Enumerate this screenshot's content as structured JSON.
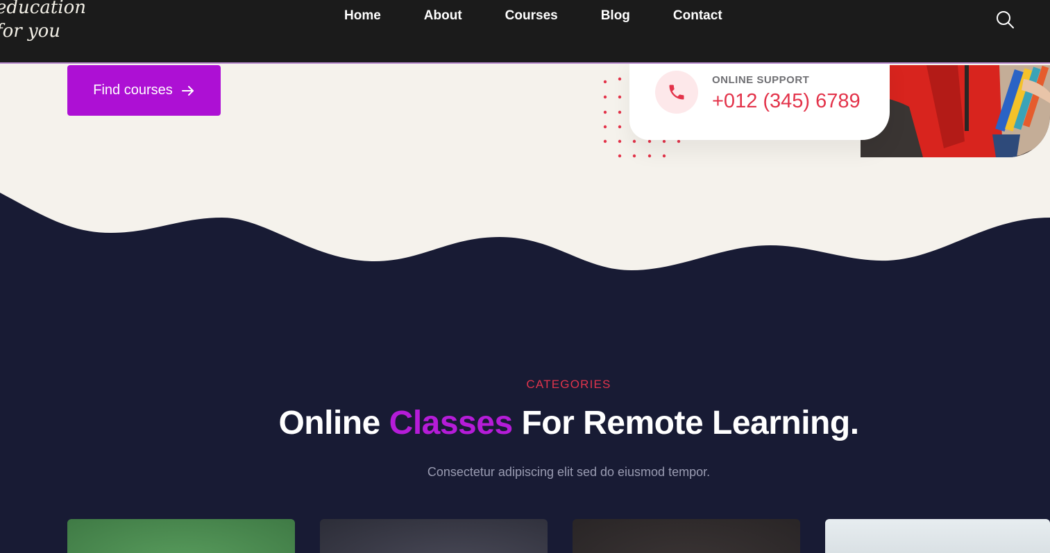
{
  "header": {
    "logo_line1": "education",
    "logo_line2": "for you",
    "nav": [
      "Home",
      "About",
      "Courses",
      "Blog",
      "Contact"
    ],
    "search_icon": "search-icon"
  },
  "hero": {
    "find_courses_label": "Find courses",
    "arrow_icon": "arrow-right-icon",
    "support_label": "ONLINE SUPPORT",
    "support_phone": "+012 (345) 6789",
    "phone_icon": "phone-icon"
  },
  "categories": {
    "eyebrow": "CATEGORIES",
    "title_part1": "Online ",
    "title_highlight": "Classes",
    "title_part2": " For Remote Learning.",
    "subtitle": "Consectetur adipiscing elit sed do eiusmod tempor."
  },
  "colors": {
    "accent_purple": "#ad10d4",
    "accent_red": "#e3334a",
    "dark_bg": "#181b34",
    "hero_bg": "#f5f2ec"
  }
}
